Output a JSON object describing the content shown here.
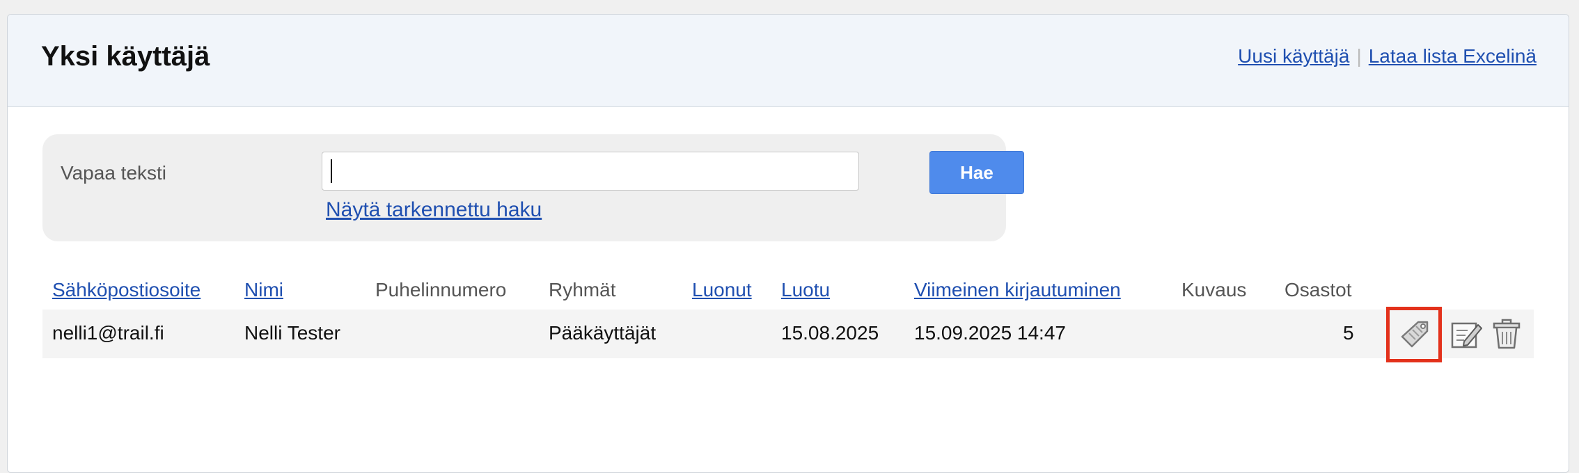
{
  "header": {
    "title": "Yksi käyttäjä",
    "links": {
      "new_user": "Uusi käyttäjä",
      "separator": "|",
      "download_excel": "Lataa lista Excelinä"
    }
  },
  "search": {
    "label": "Vapaa teksti",
    "input_value": "",
    "button_label": "Hae",
    "advanced_link": "Näytä tarkennettu haku"
  },
  "table": {
    "columns": [
      {
        "label": "Sähköpostiosoite",
        "sortable": true
      },
      {
        "label": "Nimi",
        "sortable": true
      },
      {
        "label": "Puhelinnumero",
        "sortable": false
      },
      {
        "label": "Ryhmät",
        "sortable": false
      },
      {
        "label": "Luonut",
        "sortable": true
      },
      {
        "label": "Luotu",
        "sortable": true
      },
      {
        "label": "Viimeinen kirjautuminen",
        "sortable": true
      },
      {
        "label": "Kuvaus",
        "sortable": false
      },
      {
        "label": "Osastot",
        "sortable": false
      }
    ],
    "rows": [
      {
        "email": "nelli1@trail.fi",
        "name": "Nelli Tester",
        "phone": "",
        "groups": "Pääkäyttäjät",
        "created_by": "",
        "created": "15.08.2025",
        "last_login": "15.09.2025 14:47",
        "description": "",
        "departments": "5",
        "actions": [
          "tag-icon",
          "edit-icon",
          "trash-icon"
        ]
      }
    ]
  },
  "colors": {
    "link": "#1f4fb0",
    "button": "#4f8bec",
    "highlight": "#e3311b"
  }
}
